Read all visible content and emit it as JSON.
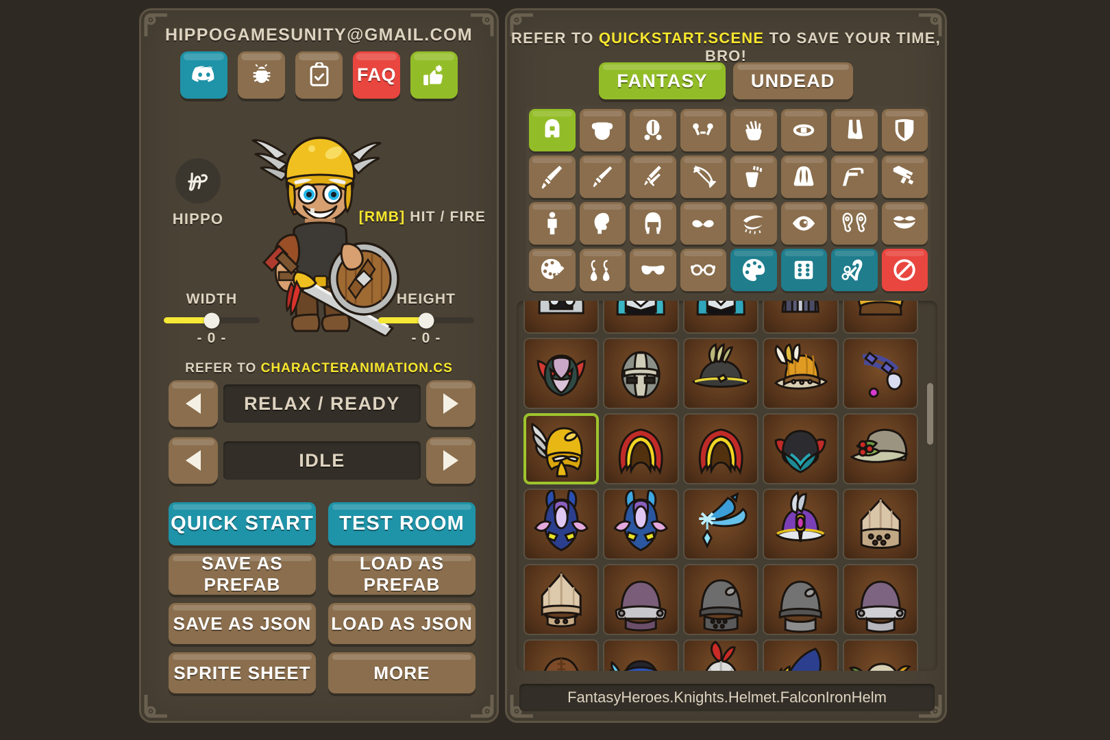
{
  "left_panel": {
    "email": "HIPPOGAMESUNITY@GMAIL.COM",
    "social_buttons": [
      {
        "name": "discord",
        "icon": "discord-icon",
        "label": "",
        "color": "#1f93a8"
      },
      {
        "name": "bug",
        "icon": "bug-icon",
        "label": "",
        "color": "#8a6e4d"
      },
      {
        "name": "clipboard",
        "icon": "clipboard-check-icon",
        "label": "",
        "color": "#8a6e4d"
      },
      {
        "name": "faq",
        "icon": "text-label",
        "label": "FAQ",
        "color": "#e8463f"
      },
      {
        "name": "rate",
        "icon": "thumbs-up-icon",
        "label": "",
        "color": "#93bd28"
      }
    ],
    "brand": {
      "logo": "hippo-monogram",
      "name": "HIPPO"
    },
    "rmb_hint": {
      "key": "[RMB]",
      "text": " HIT / FIRE"
    },
    "sliders": [
      {
        "name": "width",
        "title": "WIDTH",
        "value": "- 0 -",
        "percent": 50
      },
      {
        "name": "height",
        "title": "HEIGHT",
        "value": "- 0 -",
        "percent": 50
      }
    ],
    "anim_hint": {
      "prefix": "REFER TO ",
      "highlight": "CHARACTERANIMATION.CS"
    },
    "selectors": [
      {
        "name": "animation-set",
        "value": "RELAX / READY",
        "prev": "◀",
        "next": "▶"
      },
      {
        "name": "animation-clip",
        "value": "IDLE",
        "prev": "◀",
        "next": "▶"
      }
    ],
    "actions": [
      {
        "name": "quick-start",
        "label": "QUICK START",
        "style": "primary"
      },
      {
        "name": "test-room",
        "label": "TEST ROOM",
        "style": "primary"
      },
      {
        "name": "save-as-prefab",
        "label": "SAVE AS PREFAB",
        "style": "normal"
      },
      {
        "name": "load-as-prefab",
        "label": "LOAD AS PREFAB",
        "style": "normal"
      },
      {
        "name": "save-as-json",
        "label": "SAVE AS JSON",
        "style": "normal"
      },
      {
        "name": "load-as-json",
        "label": "LOAD AS JSON",
        "style": "normal"
      },
      {
        "name": "sprite-sheet",
        "label": "SPRITE SHEET",
        "style": "normal"
      },
      {
        "name": "more",
        "label": "MORE",
        "style": "normal"
      }
    ]
  },
  "right_panel": {
    "scene_hint": {
      "prefix": "REFER TO ",
      "highlight": "QUICKSTART.SCENE",
      "suffix": " TO SAVE YOUR TIME, BRO!"
    },
    "faction_tabs": [
      {
        "name": "fantasy",
        "label": "FANTASY",
        "active": true
      },
      {
        "name": "undead",
        "label": "UNDEAD",
        "active": false
      }
    ],
    "categories": [
      {
        "name": "helmet",
        "icon": "helmet-icon",
        "state": "selected"
      },
      {
        "name": "armor",
        "icon": "armor-icon",
        "state": "normal"
      },
      {
        "name": "pauldrons",
        "icon": "pauldrons-icon",
        "state": "normal"
      },
      {
        "name": "bracers",
        "icon": "bracers-icon",
        "state": "normal"
      },
      {
        "name": "gloves",
        "icon": "hand-icon",
        "state": "normal"
      },
      {
        "name": "belt",
        "icon": "belt-icon",
        "state": "normal"
      },
      {
        "name": "boots",
        "icon": "boots-icon",
        "state": "normal"
      },
      {
        "name": "shield",
        "icon": "shield-icon",
        "state": "normal"
      },
      {
        "name": "sword",
        "icon": "sword-icon",
        "state": "normal"
      },
      {
        "name": "dagger",
        "icon": "dagger-icon",
        "state": "normal"
      },
      {
        "name": "dual-weapon",
        "icon": "dual-swords-icon",
        "state": "normal"
      },
      {
        "name": "bow",
        "icon": "bow-icon",
        "state": "normal"
      },
      {
        "name": "quiver",
        "icon": "quiver-icon",
        "state": "normal"
      },
      {
        "name": "cape",
        "icon": "cape-icon",
        "state": "normal"
      },
      {
        "name": "pistol",
        "icon": "pistol-icon",
        "state": "normal"
      },
      {
        "name": "rifle",
        "icon": "rifle-icon",
        "state": "normal"
      },
      {
        "name": "body",
        "icon": "body-icon",
        "state": "normal"
      },
      {
        "name": "head",
        "icon": "head-icon",
        "state": "normal"
      },
      {
        "name": "hair",
        "icon": "hair-icon",
        "state": "normal"
      },
      {
        "name": "facial-hair",
        "icon": "mustache-icon",
        "state": "normal"
      },
      {
        "name": "eyebrows",
        "icon": "eyebrow-icon",
        "state": "normal"
      },
      {
        "name": "eyes",
        "icon": "eye-icon",
        "state": "normal"
      },
      {
        "name": "ears",
        "icon": "ears-icon",
        "state": "normal"
      },
      {
        "name": "mouth",
        "icon": "mouth-icon",
        "state": "normal"
      },
      {
        "name": "makeup",
        "icon": "face-paint-icon",
        "state": "normal"
      },
      {
        "name": "earrings",
        "icon": "earrings-icon",
        "state": "normal"
      },
      {
        "name": "mask",
        "icon": "mask-icon",
        "state": "normal"
      },
      {
        "name": "glasses",
        "icon": "glasses-icon",
        "state": "normal"
      },
      {
        "name": "colors",
        "icon": "palette-icon",
        "state": "teal"
      },
      {
        "name": "randomize",
        "icon": "dice-icon",
        "state": "teal"
      },
      {
        "name": "barber",
        "icon": "scissors-icon",
        "state": "teal"
      },
      {
        "name": "clear",
        "icon": "forbidden-icon",
        "state": "red"
      }
    ],
    "items": [
      {
        "row": 0,
        "col": 0,
        "art": "helm-green-silver",
        "selected": false
      },
      {
        "row": 0,
        "col": 1,
        "art": "helm-teal-silver",
        "selected": false
      },
      {
        "row": 0,
        "col": 2,
        "art": "helm-teal-silver2",
        "selected": false
      },
      {
        "row": 0,
        "col": 3,
        "art": "helm-grey-slate",
        "selected": false
      },
      {
        "row": 0,
        "col": 4,
        "art": "helm-gold-trim",
        "selected": false
      },
      {
        "row": 1,
        "col": 0,
        "art": "helm-red-demon",
        "selected": false
      },
      {
        "row": 1,
        "col": 1,
        "art": "helm-bandage-grey",
        "selected": false
      },
      {
        "row": 1,
        "col": 2,
        "art": "hat-straw-band",
        "selected": false
      },
      {
        "row": 1,
        "col": 3,
        "art": "hat-feather-gold",
        "selected": false
      },
      {
        "row": 1,
        "col": 4,
        "art": "circlet-purple-gem",
        "selected": false
      },
      {
        "row": 2,
        "col": 0,
        "art": "falcon-iron-helm",
        "selected": true
      },
      {
        "row": 2,
        "col": 1,
        "art": "hood-red-gold",
        "selected": false
      },
      {
        "row": 2,
        "col": 2,
        "art": "hood-red-gold2",
        "selected": false
      },
      {
        "row": 2,
        "col": 3,
        "art": "helm-black-teal",
        "selected": false
      },
      {
        "row": 2,
        "col": 4,
        "art": "druid-leaf-hood",
        "selected": false
      },
      {
        "row": 3,
        "col": 0,
        "art": "helm-blue-dragon",
        "selected": false
      },
      {
        "row": 3,
        "col": 1,
        "art": "helm-cyan-dragon",
        "selected": false
      },
      {
        "row": 3,
        "col": 2,
        "art": "hat-ice-wizard",
        "selected": false
      },
      {
        "row": 3,
        "col": 3,
        "art": "hat-purple-plume",
        "selected": false
      },
      {
        "row": 3,
        "col": 4,
        "art": "helm-tan-nasal",
        "selected": false
      },
      {
        "row": 4,
        "col": 0,
        "art": "helm-tan-knight",
        "selected": false
      },
      {
        "row": 4,
        "col": 1,
        "art": "helm-purple-visor",
        "selected": false
      },
      {
        "row": 4,
        "col": 2,
        "art": "helm-grey-mail",
        "selected": false
      },
      {
        "row": 4,
        "col": 3,
        "art": "helm-grey-pot",
        "selected": false
      },
      {
        "row": 4,
        "col": 4,
        "art": "helm-mauve-visor",
        "selected": false
      },
      {
        "row": 5,
        "col": 0,
        "art": "helm-brown-leather",
        "selected": false
      },
      {
        "row": 5,
        "col": 1,
        "art": "hood-blue-feather",
        "selected": false
      },
      {
        "row": 5,
        "col": 2,
        "art": "helm-white-crest",
        "selected": false
      },
      {
        "row": 5,
        "col": 3,
        "art": "hat-blue-moon",
        "selected": false
      },
      {
        "row": 5,
        "col": 4,
        "art": "helm-olive-leaf",
        "selected": false
      }
    ],
    "status": "FantasyHeroes.Knights.Helmet.FalconIronHelm"
  },
  "colors": {
    "background": "#2e2a23",
    "panel": "#4a4235",
    "accent_teal": "#1f93a8",
    "accent_green": "#93bd28",
    "accent_red": "#e8463f",
    "accent_yellow": "#f7e62e",
    "button_brown": "#8a6e4d",
    "text": "#ded3c0"
  }
}
